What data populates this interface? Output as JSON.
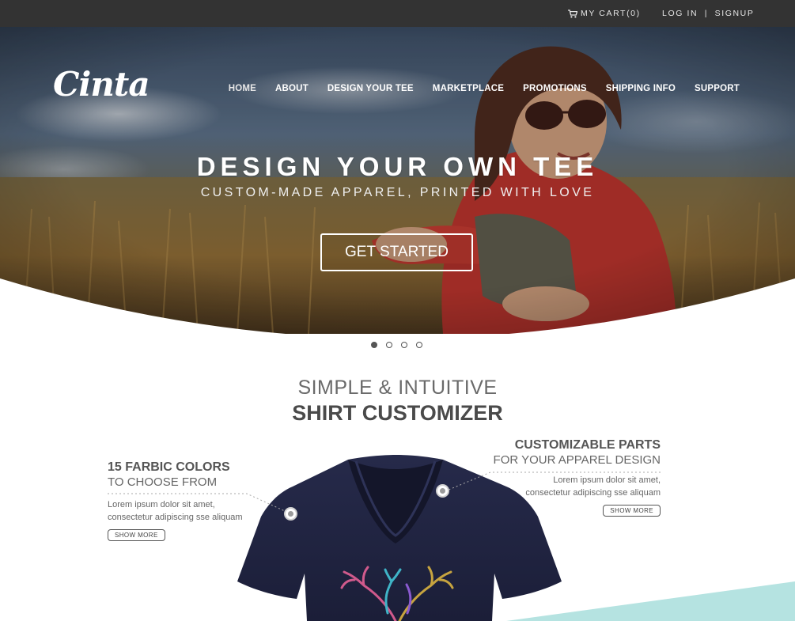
{
  "topbar": {
    "cart_label": "MY CART(0)",
    "login_label": "LOG IN",
    "separator": "|",
    "signup_label": "SIGNUP"
  },
  "brand": {
    "logo_text": "Cinta"
  },
  "nav": {
    "items": [
      {
        "label": "HOME"
      },
      {
        "label": "ABOUT"
      },
      {
        "label": "DESIGN YOUR TEE"
      },
      {
        "label": "MARKETPLACE"
      },
      {
        "label": "PROMOTIONS"
      },
      {
        "label": "SHIPPING INFO"
      },
      {
        "label": "SUPPORT"
      }
    ]
  },
  "hero": {
    "title": "DESIGN YOUR OWN TEE",
    "subtitle": "CUSTOM-MADE APPAREL, PRINTED WITH LOVE",
    "cta_label": "GET STARTED"
  },
  "carousel": {
    "slide_count": 4,
    "active_index": 0
  },
  "section": {
    "line1": "SIMPLE & INTUITIVE",
    "line2": "SHIRT CUSTOMIZER"
  },
  "features": {
    "left": {
      "title": "15 FARBIC COLORS",
      "subtitle": "TO CHOOSE FROM",
      "body_line1": "Lorem ipsum dolor sit amet,",
      "body_line2": "consectetur adipiscing sse aliquam",
      "button_label": "SHOW MORE"
    },
    "right": {
      "title": "CUSTOMIZABLE PARTS",
      "subtitle": "FOR YOUR APPAREL DESIGN",
      "body_line1": "Lorem ipsum dolor sit amet,",
      "body_line2": "consectetur adipiscing sse aliquam",
      "button_label": "SHOW MORE"
    }
  },
  "colors": {
    "topbar_bg": "#333333",
    "shirt_navy": "#1f2341",
    "accent_teal": "#b5e3e1",
    "text_gray": "#555555"
  },
  "icons": {
    "cart": "shopping-cart-icon",
    "hotspot": "hotspot-marker-icon"
  }
}
